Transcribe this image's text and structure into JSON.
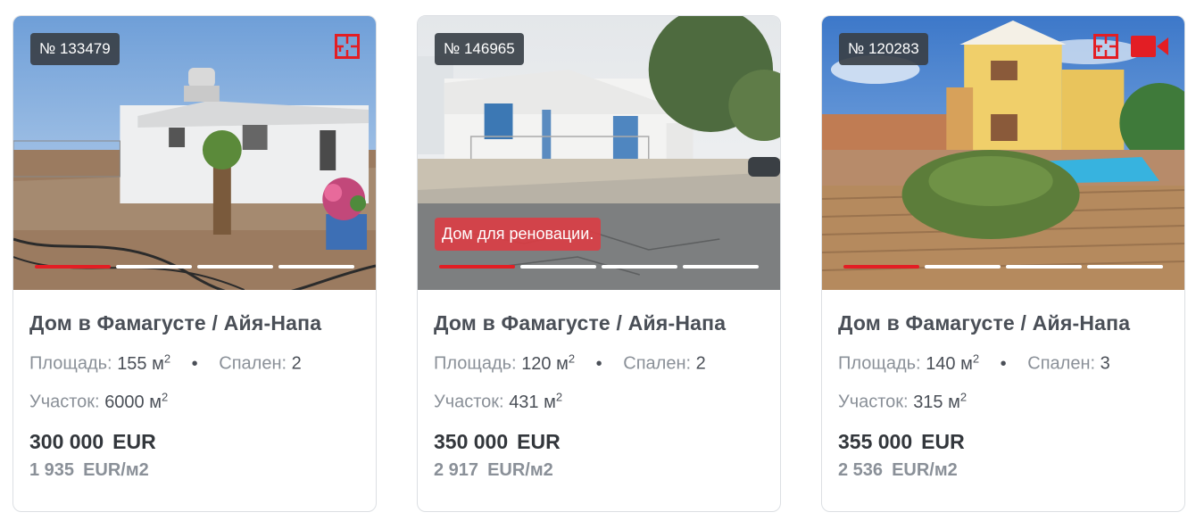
{
  "listings": [
    {
      "id_label": "№ 133479",
      "title": "Дом в Фамагусте / Айя-Напа",
      "area_label": "Площадь:",
      "area_value": "155 м",
      "area_unit_sup": "2",
      "bullet": "•",
      "bedrooms_label": "Спален:",
      "bedrooms_value": "2",
      "plot_label": "Участок:",
      "plot_value": "6000 м",
      "plot_unit_sup": "2",
      "price": "300 000",
      "currency": "EUR",
      "price_per_m2": "1 935",
      "price_per_m2_unit": "EUR/м2",
      "icons": [
        "floorplan-icon"
      ],
      "slides_total": 4,
      "slide_active": 1
    },
    {
      "id_label": "№ 146965",
      "tag": "Дом для реновации.",
      "title": "Дом в Фамагусте / Айя-Напа",
      "area_label": "Площадь:",
      "area_value": "120 м",
      "area_unit_sup": "2",
      "bullet": "•",
      "bedrooms_label": "Спален:",
      "bedrooms_value": "2",
      "plot_label": "Участок:",
      "plot_value": "431 м",
      "plot_unit_sup": "2",
      "price": "350 000",
      "currency": "EUR",
      "price_per_m2": "2 917",
      "price_per_m2_unit": "EUR/м2",
      "icons": [],
      "slides_total": 4,
      "slide_active": 1
    },
    {
      "id_label": "№ 120283",
      "title": "Дом в Фамагусте / Айя-Напа",
      "area_label": "Площадь:",
      "area_value": "140 м",
      "area_unit_sup": "2",
      "bullet": "•",
      "bedrooms_label": "Спален:",
      "bedrooms_value": "3",
      "plot_label": "Участок:",
      "plot_value": "315 м",
      "plot_unit_sup": "2",
      "price": "355 000",
      "currency": "EUR",
      "price_per_m2": "2 536",
      "price_per_m2_unit": "EUR/м2",
      "icons": [
        "floorplan-icon",
        "video-camera-icon"
      ],
      "slides_total": 4,
      "slide_active": 1
    }
  ],
  "colors": {
    "accent": "#e31e24",
    "badge_bg": "#3a4048",
    "tag_bg": "#db3d44",
    "title": "#4a4f57",
    "muted": "#8a9098"
  }
}
